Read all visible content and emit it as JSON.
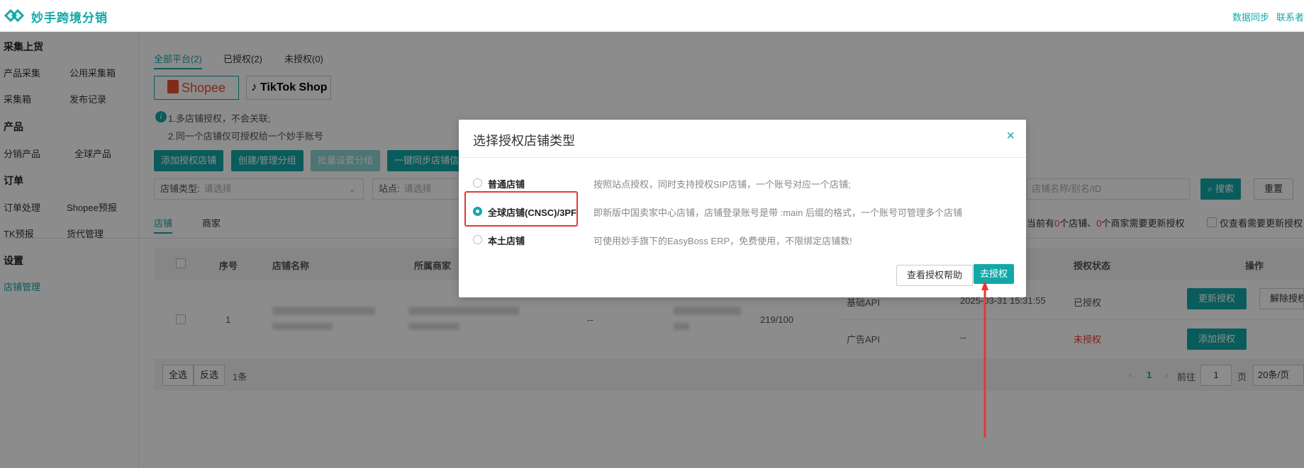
{
  "header": {
    "brand": "妙手跨境分销",
    "links": [
      "数据同步",
      "联系者"
    ]
  },
  "sidebar": {
    "sections": [
      {
        "title": "采集上货",
        "items": [
          "产品采集",
          "公用采集箱",
          "采集箱",
          "发布记录"
        ]
      },
      {
        "title": "产品",
        "items": [
          "分销产品",
          "全球产品"
        ]
      },
      {
        "title": "订单",
        "items": [
          "订单处理",
          "Shopee预报",
          "TK预报",
          "货代管理"
        ]
      },
      {
        "title": "设置",
        "items": [
          "店铺管理"
        ]
      }
    ]
  },
  "main": {
    "platform_tabs": [
      "全部平台(2)",
      "已授权(2)",
      "未授权(0)"
    ],
    "platforms": [
      "Shopee",
      "TikTok Shop"
    ],
    "tips": [
      "1.多店铺授权，不会关联;",
      "2.同一个店铺仅可授权给一个妙手账号"
    ],
    "toolbar": [
      "添加授权店铺",
      "创建/管理分组",
      "批量设置分组",
      "一键同步店铺信"
    ],
    "filters": {
      "store_type_label": "店铺类型:",
      "store_type_placeholder": "请选择",
      "site_label": "站点:",
      "site_placeholder": "请选择",
      "search_placeholder": "店铺名称/别名/ID",
      "search_button": "搜索",
      "reset_button": "重置"
    },
    "sub_tabs": [
      "店铺",
      "商家"
    ],
    "notice": {
      "prefix": "当前有",
      "stores": "0",
      "mid": "个店铺、",
      "merchants": "0",
      "suffix": "个商家需要更新授权"
    },
    "only_view_label": "仅查看需要更新授权",
    "table": {
      "headers": [
        "序号",
        "店铺名称",
        "所属商家",
        "授权状态",
        "操作"
      ],
      "row": {
        "index": "1",
        "dash": "--",
        "quota": "219/100",
        "apis": [
          {
            "name": "基础API",
            "time": "2025-03-31 15:31:55",
            "status": "已授权",
            "action": "更新授权",
            "action2": "解除授权"
          },
          {
            "name": "广告API",
            "time": "--",
            "status": "未授权",
            "action": "添加授权"
          }
        ]
      }
    },
    "footer": {
      "select_all": "全选",
      "invert": "反选",
      "count": "1条",
      "page": "1",
      "goto_label": "前往",
      "goto_value": "1",
      "page_unit": "页",
      "page_size": "20条/页"
    }
  },
  "modal": {
    "title": "选择授权店铺类型",
    "options": [
      {
        "label": "普通店铺",
        "desc": "按照站点授权，同时支持授权SIP店铺，一个账号对应一个店铺;"
      },
      {
        "label": "全球店铺(CNSC)/3PF",
        "desc": "即新版中国卖家中心店铺，店铺登录账号是带 :main 后缀的格式，一个账号可管理多个店铺"
      },
      {
        "label": "本土店铺",
        "desc": "可使用妙手旗下的EasyBoss ERP，免费使用，不限绑定店铺数!"
      }
    ],
    "selected_index": 1,
    "help_button": "查看授权帮助",
    "confirm_button": "去授权"
  },
  "colors": {
    "accent": "#13a8a8",
    "highlight": "#e53935",
    "danger": "#e53935"
  }
}
